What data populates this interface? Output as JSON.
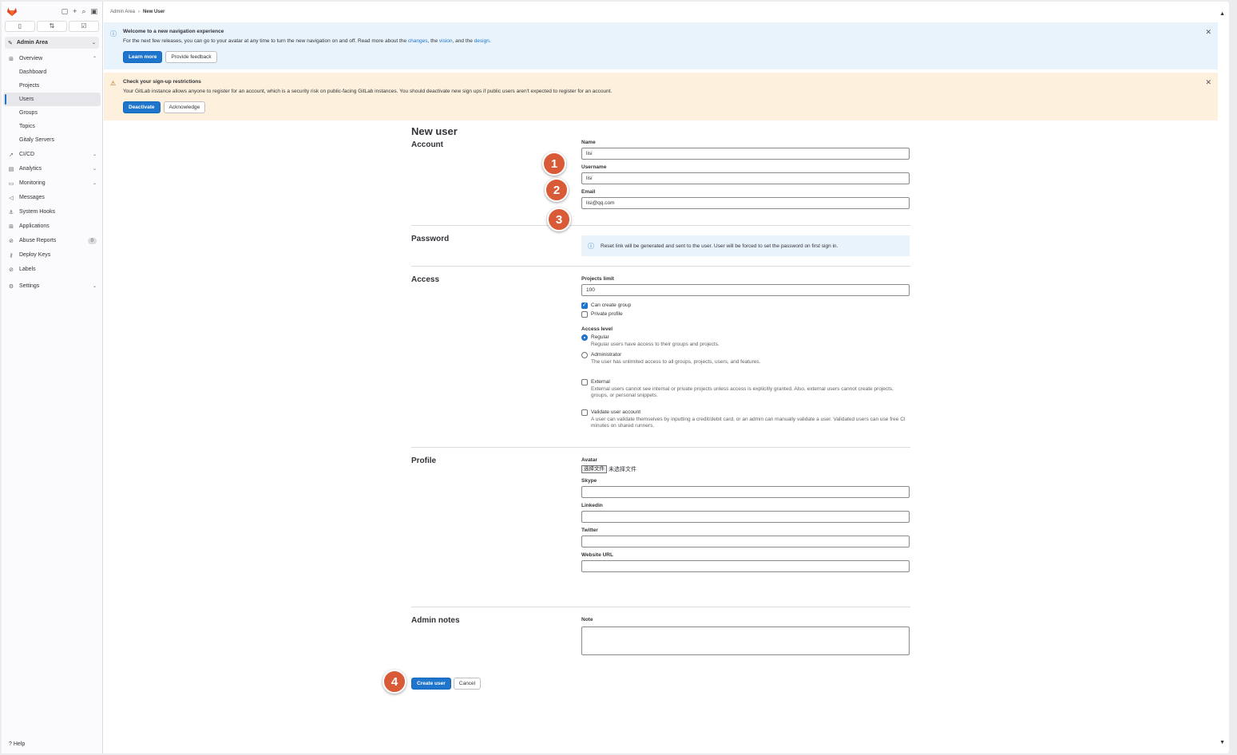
{
  "sidebar": {
    "context": "Admin Area",
    "overview": "Overview",
    "sub_items": [
      "Dashboard",
      "Projects",
      "Users",
      "Groups",
      "Topics",
      "Gitaly Servers"
    ],
    "items": [
      {
        "label": "CI/CD",
        "icon": "rocket-icon"
      },
      {
        "label": "Analytics",
        "icon": "chart-icon"
      },
      {
        "label": "Monitoring",
        "icon": "monitor-icon"
      },
      {
        "label": "Messages",
        "icon": "megaphone-icon"
      },
      {
        "label": "System Hooks",
        "icon": "anchor-icon"
      },
      {
        "label": "Applications",
        "icon": "grid-icon"
      },
      {
        "label": "Abuse Reports",
        "icon": "abuse-icon",
        "badge": "0"
      },
      {
        "label": "Deploy Keys",
        "icon": "key-icon"
      },
      {
        "label": "Labels",
        "icon": "label-icon"
      },
      {
        "label": "Settings",
        "icon": "gear-icon"
      }
    ],
    "help": "Help"
  },
  "breadcrumb": {
    "root": "Admin Area",
    "current": "New User"
  },
  "info_alert": {
    "title": "Welcome to a new navigation experience",
    "text_before": "For the next few releases, you can go to your avatar at any time to turn the new navigation on and off. Read more about the ",
    "link1": "changes",
    "mid1": ", the ",
    "link2": "vision",
    "mid2": ", and the ",
    "link3": "design",
    "end": ".",
    "btn_primary": "Learn more",
    "btn_secondary": "Provide feedback"
  },
  "warn_alert": {
    "title": "Check your sign-up restrictions",
    "text": "Your GitLab instance allows anyone to register for an account, which is a security risk on public-facing GitLab instances. You should deactivate new sign ups if public users aren't expected to register for an account.",
    "btn_primary": "Deactivate",
    "btn_secondary": "Acknowledge"
  },
  "form": {
    "title": "New user",
    "account": {
      "title": "Account",
      "name_label": "Name",
      "name_value": "lisi",
      "username_label": "Username",
      "username_value": "lisi",
      "email_label": "Email",
      "email_value": "lisi@qq.com"
    },
    "password": {
      "title": "Password",
      "info": "Reset link will be generated and sent to the user. User will be forced to set the password on first sign in."
    },
    "access": {
      "title": "Access",
      "projects_limit_label": "Projects limit",
      "projects_limit_value": "100",
      "can_create_group": "Can create group",
      "private_profile": "Private profile",
      "access_level_label": "Access level",
      "regular": "Regular",
      "regular_help": "Regular users have access to their groups and projects.",
      "administrator": "Administrator",
      "administrator_help": "The user has unlimited access to all groups, projects, users, and features.",
      "external": "External",
      "external_help": "External users cannot see internal or private projects unless access is explicitly granted. Also, external users cannot create projects, groups, or personal snippets.",
      "validate": "Validate user account",
      "validate_help": "A user can validate themselves by inputting a credit/debit card, or an admin can manually validate a user. Validated users can use free CI minutes on shared runners."
    },
    "profile": {
      "title": "Profile",
      "avatar_label": "Avatar",
      "file_button": "选择文件",
      "file_none": "未选择文件",
      "skype_label": "Skype",
      "linkedin_label": "Linkedin",
      "twitter_label": "Twitter",
      "website_label": "Website URL"
    },
    "admin_notes": {
      "title": "Admin notes",
      "note_label": "Note"
    },
    "submit": "Create user",
    "cancel": "Cancel"
  },
  "markers": [
    "1",
    "2",
    "3",
    "4"
  ],
  "colors": {
    "accent": "#1f75cb",
    "marker": "#d95a37",
    "info_bg": "#e9f3fc",
    "warn_bg": "#fdf1dd"
  }
}
